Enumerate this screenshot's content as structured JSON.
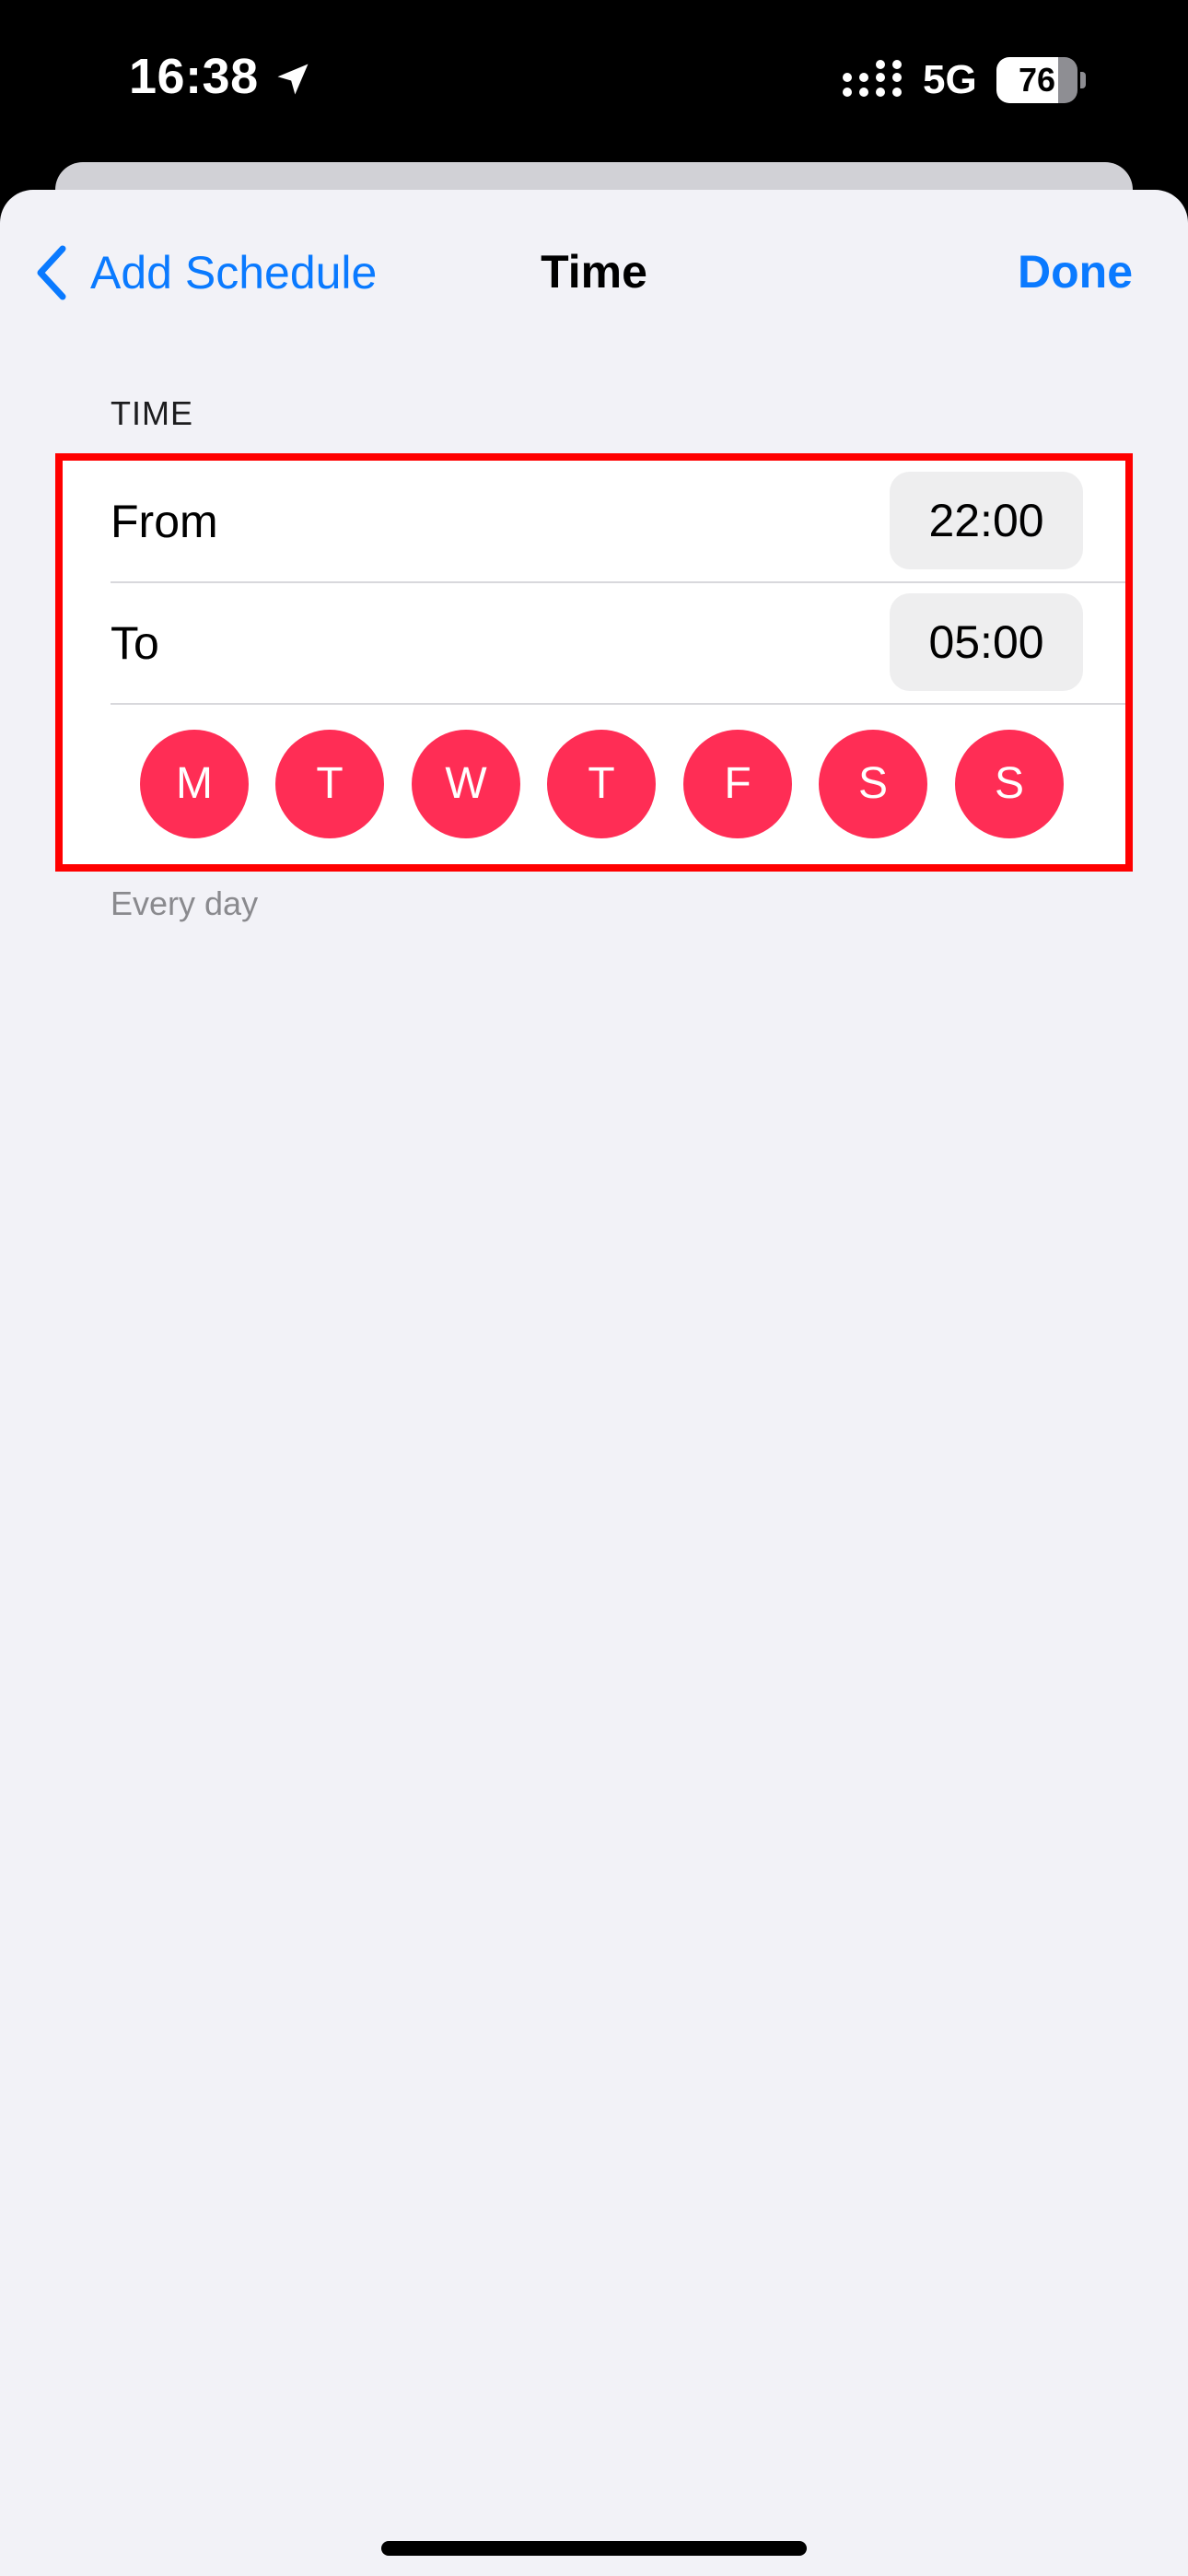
{
  "status_bar": {
    "time": "16:38",
    "network": "5G",
    "battery": {
      "level": 76,
      "label": "76"
    },
    "icons": {
      "location": "location-arrow-icon",
      "signal": "cellular-signal-icon",
      "battery": "battery-icon"
    }
  },
  "nav": {
    "back_label": "Add Schedule",
    "title": "Time",
    "done_label": "Done"
  },
  "time_section": {
    "header": "TIME",
    "from_label": "From",
    "from_value": "22:00",
    "to_label": "To",
    "to_value": "05:00",
    "days": [
      {
        "label": "M",
        "selected": true
      },
      {
        "label": "T",
        "selected": true
      },
      {
        "label": "W",
        "selected": true
      },
      {
        "label": "T",
        "selected": true
      },
      {
        "label": "F",
        "selected": true
      },
      {
        "label": "S",
        "selected": true
      },
      {
        "label": "S",
        "selected": true
      }
    ],
    "footer": "Every day"
  },
  "colors": {
    "accent": "#0a7aff",
    "day_selected": "#ff2d55",
    "highlight_border": "#ff0000",
    "background": "#f2f2f7"
  }
}
